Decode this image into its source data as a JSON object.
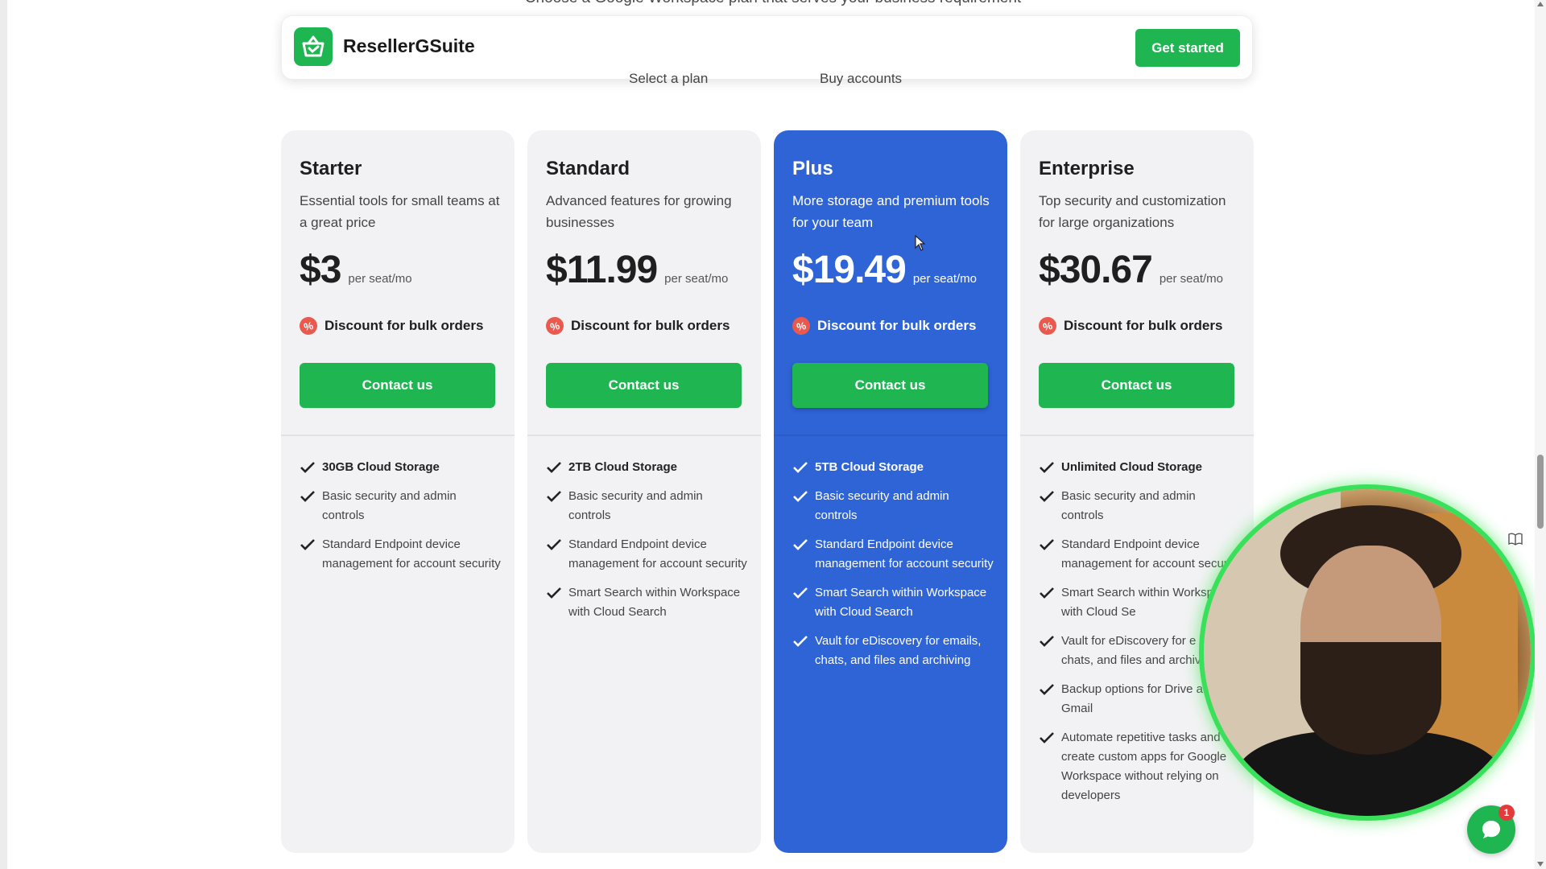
{
  "page": {
    "subtitle_cut": "Choose a Google Workspace plan that serves your business requirement"
  },
  "header": {
    "brand": "ResellerGSuite",
    "cta_label": "Get started",
    "steps": [
      "Select a plan",
      "Buy accounts"
    ]
  },
  "plans": [
    {
      "name": "Starter",
      "description": "Essential tools for small teams at a great price",
      "price": "$3",
      "price_unit": "per seat/mo",
      "discount": "Discount for bulk orders",
      "button": "Contact us",
      "features": [
        "30GB Cloud Storage",
        "Basic security and admin controls",
        "Standard Endpoint device management for account security"
      ]
    },
    {
      "name": "Standard",
      "description": "Advanced features for growing businesses",
      "price": "$11.99",
      "price_unit": "per seat/mo",
      "discount": "Discount for bulk orders",
      "button": "Contact us",
      "features": [
        "2TB Cloud Storage",
        "Basic security and admin controls",
        "Standard Endpoint device management for account security",
        "Smart Search within Workspace with Cloud Search"
      ]
    },
    {
      "name": "Plus",
      "description": "More storage and premium tools for your team",
      "price": "$19.49",
      "price_unit": "per seat/mo",
      "discount": "Discount for bulk orders",
      "button": "Contact us",
      "features": [
        "5TB Cloud Storage",
        "Basic security and admin controls",
        "Standard Endpoint device management for account security",
        "Smart Search within Workspace with Cloud Search",
        "Vault for eDiscovery for emails, chats, and files and archiving"
      ]
    },
    {
      "name": "Enterprise",
      "description": "Top security and customization for large organizations",
      "price": "$30.67",
      "price_unit": "per seat/mo",
      "discount": "Discount for bulk orders",
      "button": "Contact us",
      "features": [
        "Unlimited Cloud Storage",
        "Basic security and admin controls",
        "Standard Endpoint device management for account security",
        "Smart Search within Workspace with Cloud Se",
        "Vault for eDiscovery for e",
        "chats, and files and archiv",
        "Backup options for Drive an",
        "Gmail",
        "Automate repetitive tasks and create custom apps for Google Workspace without relying on developers"
      ]
    }
  ],
  "chat": {
    "badge_count": "1"
  },
  "colors": {
    "brand_green": "#1fb652",
    "plus_blue": "#2f64d6",
    "card_gray": "#f2f2f4",
    "discount_red": "#e9594d"
  },
  "icons": [
    "shopping-basket-icon",
    "discount-icon",
    "check-icon",
    "chat-icon",
    "book-icon",
    "cursor-icon"
  ]
}
